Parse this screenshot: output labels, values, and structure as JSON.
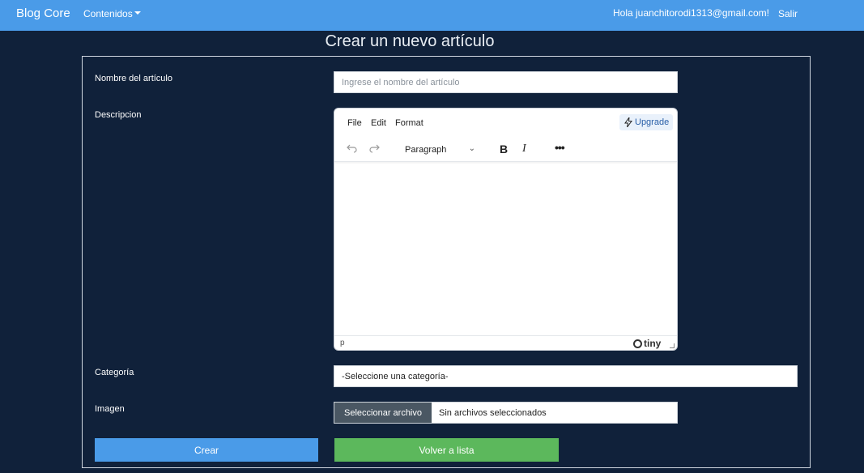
{
  "nav": {
    "brand": "Blog Core",
    "contents_label": "Contenidos",
    "greeting": "Hola juanchitorodi1313@gmail.com!",
    "logout_label": "Salir"
  },
  "page": {
    "title": "Crear un nuevo artículo"
  },
  "form": {
    "name_label": "Nombre del artículo",
    "name_placeholder": "Ingrese el nombre del artículo",
    "description_label": "Descripcion",
    "category_label": "Categoría",
    "category_selected": "-Seleccione una categoría-",
    "image_label": "Imagen",
    "file_button_label": "Seleccionar archivo",
    "file_status": "Sin archivos seleccionados",
    "create_button": "Crear",
    "back_button": "Volver a lista"
  },
  "editor": {
    "menu": [
      "File",
      "Edit",
      "Format"
    ],
    "upgrade_label": "Upgrade",
    "block_format": "Paragraph",
    "status_path": "p",
    "brand_label": "tiny"
  },
  "colors": {
    "background": "#10213a",
    "navbar": "#4a9be8",
    "primary": "#4a9be8",
    "success": "#5cb85c",
    "file_button": "#4a5763"
  }
}
